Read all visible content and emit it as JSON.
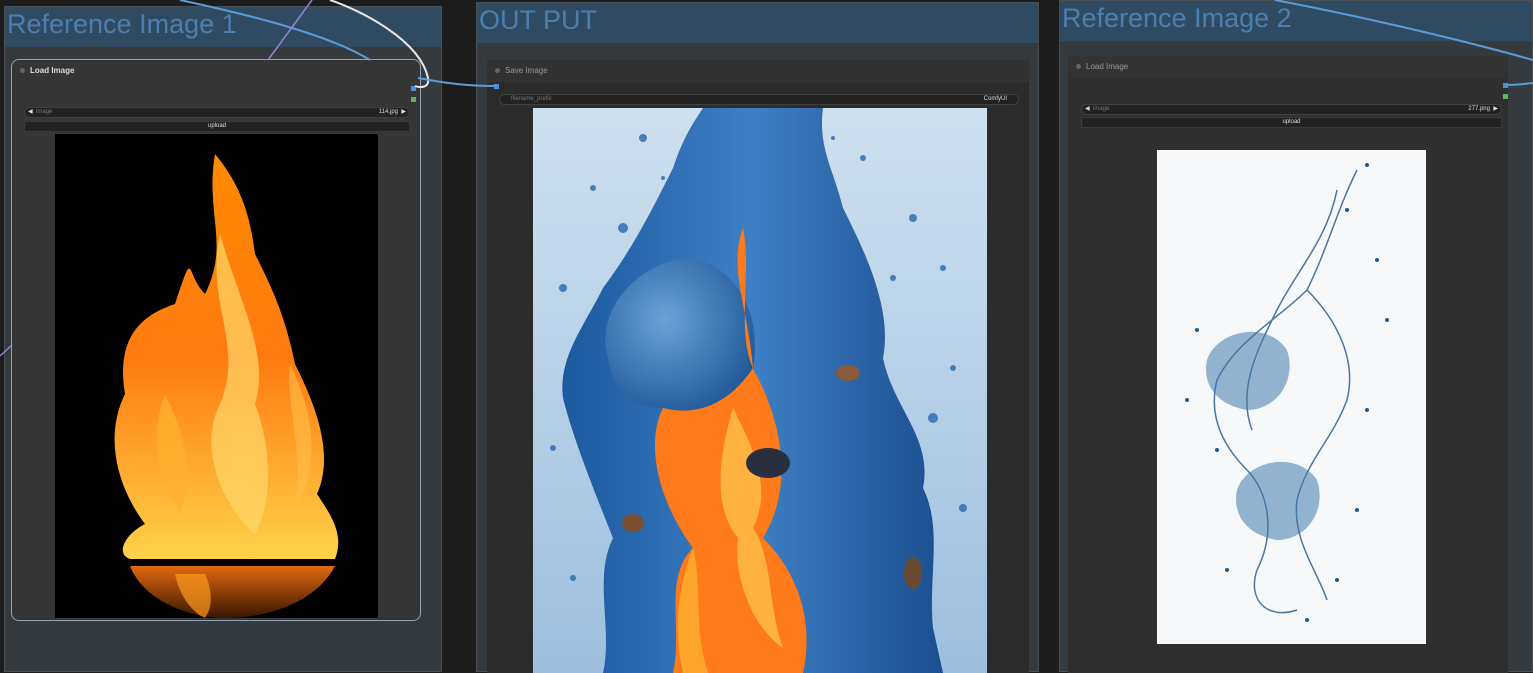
{
  "groups": {
    "left": {
      "title": "Reference Image 1"
    },
    "center": {
      "title": "OUT PUT"
    },
    "right": {
      "title": "Reference Image 2"
    }
  },
  "load_node_1": {
    "title": "Load Image",
    "image_label": "image",
    "image_value": "114.jpg",
    "upload_label": "upload"
  },
  "save_node": {
    "title": "Save Image",
    "prefix_label": "filename_prefix",
    "prefix_value": "ComfyUI"
  },
  "load_node_2": {
    "title": "Load Image",
    "image_label": "image",
    "image_value": "277.png",
    "upload_label": "upload"
  },
  "colors": {
    "group_header": "#2f4b62",
    "group_title": "#4b7fb0",
    "link_blue": "#5a9bd8",
    "link_white": "#e6e6e6",
    "link_purple": "#9b7fd0",
    "slot_blue": "#4a90d9",
    "slot_green": "#5fb65f"
  },
  "icons": [
    "arrow-left-icon",
    "arrow-right-icon",
    "node-status-dot-icon"
  ]
}
